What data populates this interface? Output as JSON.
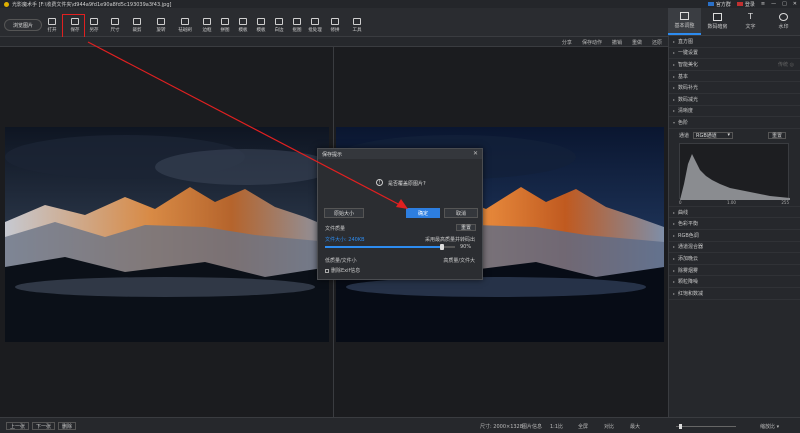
{
  "window": {
    "title": "光影魔术手 [F:\\收费文件夹\\d944a9fd1e90a8fd5c193039a3f43.jpg]",
    "right_buttons": [
      "官方群",
      "登录"
    ]
  },
  "toolbar": {
    "open_label": "浏览图片",
    "tools": [
      {
        "id": "open",
        "label": "打开",
        "icon": "folder-icon"
      },
      {
        "id": "save",
        "label": "保存",
        "icon": "floppy-icon"
      },
      {
        "id": "saveas",
        "label": "另存",
        "icon": "save-as-icon"
      },
      {
        "id": "size",
        "label": "尺寸",
        "icon": "resize-icon"
      },
      {
        "id": "crop",
        "label": "裁剪",
        "icon": "crop-icon"
      },
      {
        "id": "rotate",
        "label": "旋转",
        "icon": "rotate-icon"
      },
      {
        "id": "stamp",
        "label": "祛斑刷",
        "icon": "brush-icon"
      },
      {
        "id": "border",
        "label": "边框",
        "icon": "border-icon"
      },
      {
        "id": "puzzle",
        "label": "拼图",
        "icon": "puzzle-icon"
      },
      {
        "id": "template",
        "label": "模板",
        "icon": "template-icon"
      },
      {
        "id": "print",
        "label": "模板",
        "icon": "print-icon"
      },
      {
        "id": "text",
        "label": "白边",
        "icon": "text-icon"
      },
      {
        "id": "watermark",
        "label": "抠图",
        "icon": "pin-icon"
      },
      {
        "id": "batch",
        "label": "批处理",
        "icon": "batch-icon"
      },
      {
        "id": "share",
        "label": "修拼",
        "icon": "share-icon"
      },
      {
        "id": "more",
        "label": "工具",
        "icon": "more-icon"
      }
    ]
  },
  "right_tabs": [
    {
      "label": "基本调整",
      "icon": "adjust-icon",
      "active": true
    },
    {
      "label": "数码暗房",
      "icon": "camera-icon",
      "active": false
    },
    {
      "label": "文字",
      "icon": "text-t-icon",
      "active": false
    },
    {
      "label": "水印",
      "icon": "watermark-icon",
      "active": false
    }
  ],
  "subbar": {
    "items": [
      "分享",
      "保存动作",
      "撤销",
      "重做",
      "还原"
    ]
  },
  "dialog": {
    "title": "保存提示",
    "question": "是否覆盖原图片?",
    "original_size_btn": "原始大小",
    "confirm_btn": "确定",
    "cancel_btn": "取消",
    "quality_label": "文件质量",
    "reset_btn": "重置",
    "filesize_label": "文件大小: 240KB",
    "sample_label": "采用最高质量并转码出",
    "quality_percent": "90%",
    "quality_value": 0.9,
    "low_label": "低质量/文件小",
    "high_label": "高质量/文件大",
    "exif_label": "删除Exif信息"
  },
  "right_panel": {
    "items_top": [
      {
        "label": "直方图"
      },
      {
        "label": "一键设置"
      },
      {
        "label": "智能美化",
        "extra": "传统 ◎"
      },
      {
        "label": "基本"
      },
      {
        "label": "数码补光"
      },
      {
        "label": "数码减光"
      },
      {
        "label": "清晰度"
      },
      {
        "label": "色阶",
        "expanded": true
      }
    ],
    "histogram": {
      "channel_label": "通道",
      "channel_value": "RGB通道",
      "reset_label": "重置",
      "axis_min": "0",
      "axis_mid": "1.00",
      "axis_max": "255"
    },
    "items_bottom": [
      {
        "label": "曲线"
      },
      {
        "label": "色彩平衡"
      },
      {
        "label": "RGB色调"
      },
      {
        "label": "通道混合器"
      },
      {
        "label": "添加晚云"
      },
      {
        "label": "除雾烟雾"
      },
      {
        "label": "颗粒降噪"
      },
      {
        "label": "红饱和数减"
      }
    ]
  },
  "statusbar": {
    "prev": "上一张",
    "next": "下一张",
    "delete": "删除",
    "dimensions": "尺寸: 2000×1328",
    "info": "图片信息",
    "ratio": "1:1比",
    "fullscreen": "全屏",
    "compare": "对比",
    "fit": "最大",
    "zoom_value": 0.05,
    "zoom_label": "缩放比 ▾"
  }
}
